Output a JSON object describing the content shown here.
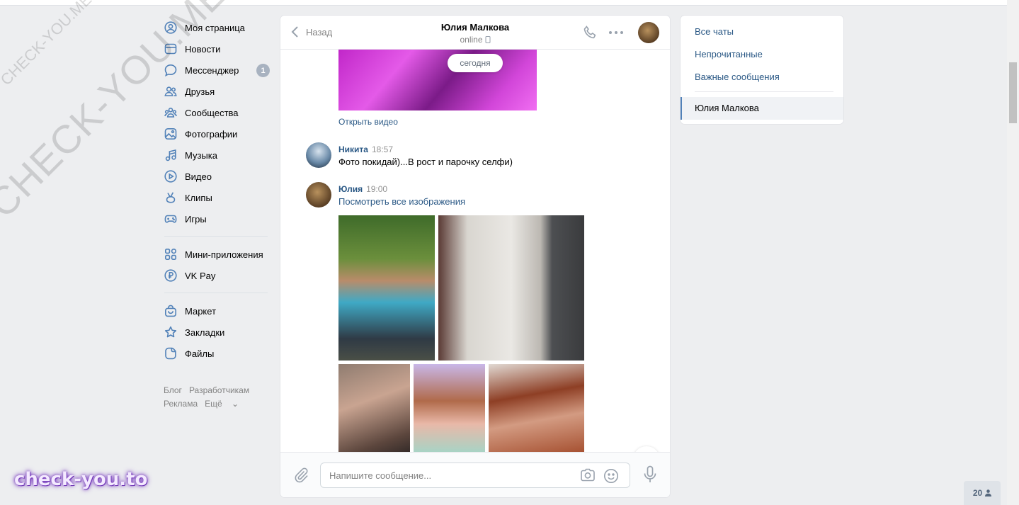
{
  "nav": {
    "items": [
      {
        "id": "profile",
        "label": "Моя страница",
        "icon": "user-circle-icon"
      },
      {
        "id": "news",
        "label": "Новости",
        "icon": "newspaper-icon"
      },
      {
        "id": "messenger",
        "label": "Мессенджер",
        "icon": "chat-bubble-icon",
        "badge": "1"
      },
      {
        "id": "friends",
        "label": "Друзья",
        "icon": "friends-icon"
      },
      {
        "id": "communities",
        "label": "Сообщества",
        "icon": "communities-icon"
      },
      {
        "id": "photos",
        "label": "Фотографии",
        "icon": "photo-icon"
      },
      {
        "id": "music",
        "label": "Музыка",
        "icon": "music-note-icon"
      },
      {
        "id": "video",
        "label": "Видео",
        "icon": "play-circle-icon"
      },
      {
        "id": "clips",
        "label": "Клипы",
        "icon": "clips-icon"
      },
      {
        "id": "games",
        "label": "Игры",
        "icon": "gamepad-icon"
      },
      {
        "id": "miniapps",
        "label": "Мини-приложения",
        "icon": "grid-icon"
      },
      {
        "id": "vkpay",
        "label": "VK Pay",
        "icon": "ruble-coin-icon"
      },
      {
        "id": "market",
        "label": "Маркет",
        "icon": "bag-icon"
      },
      {
        "id": "bookmarks",
        "label": "Закладки",
        "icon": "star-icon"
      },
      {
        "id": "files",
        "label": "Файлы",
        "icon": "file-icon"
      }
    ]
  },
  "footer": {
    "blog": "Блог",
    "developers": "Разработчикам",
    "ads": "Реклама",
    "more": "Ещё"
  },
  "chat": {
    "back_label": "Назад",
    "title": "Юлия Малкова",
    "status": "online",
    "date_pill": "сегодня",
    "open_video": "Открыть видео",
    "messages": [
      {
        "author": "Никита",
        "time": "18:57",
        "text": "Фото покидай)...В рост и парочку селфи)"
      },
      {
        "author": "Юлия",
        "time": "19:00",
        "link": "Посмотреть все изображения"
      }
    ],
    "input_placeholder": "Напишите сообщение..."
  },
  "right_panel": {
    "all_chats": "Все чаты",
    "unread": "Непрочитанные",
    "important": "Важные сообщения",
    "active_chat": "Юлия Малкова"
  },
  "watermarks": {
    "small": "CHECK-YOU.ME",
    "large": "CHECK-YOU.ME",
    "brand": "check-you.to"
  },
  "online_count": "20",
  "colors": {
    "link": "#2a5885",
    "badge": "#a8b2c0",
    "background": "#edeef0",
    "active_border": "#5181b8"
  }
}
